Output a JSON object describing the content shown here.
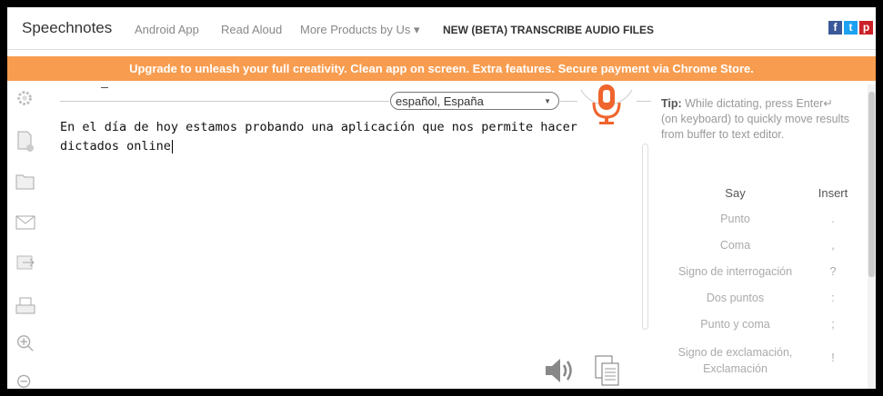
{
  "header": {
    "brand": "Speechnotes",
    "nav": [
      "Android App",
      "Read Aloud",
      "More Products by Us ▾"
    ],
    "nav_highlight": "NEW (BETA) TRANSCRIBE AUDIO FILES",
    "social": [
      {
        "icon": "facebook-icon",
        "glyph": "f",
        "color": "#3b5998"
      },
      {
        "icon": "twitter-icon",
        "glyph": "t",
        "color": "#1da1f2"
      },
      {
        "icon": "pinterest-icon",
        "glyph": "p",
        "color": "#cb2027"
      }
    ]
  },
  "banner": {
    "text": "Upgrade to unleash your full creativity. Clean app on screen. Extra features. Secure payment via Chrome Store.",
    "color": "#f89c4f"
  },
  "sidebar": {
    "icons": [
      "settings-icon",
      "new-file-icon",
      "open-folder-icon",
      "email-icon",
      "share-icon",
      "print-icon",
      "zoom-in-icon",
      "zoom-out-icon"
    ]
  },
  "editor": {
    "language": "español, España",
    "text": "En el día de hoy estamos probando una aplicación que nos permite hacer dictados online",
    "mic_color": "#f0642d"
  },
  "tips": {
    "label": "Tip:",
    "text": "While dictating, press Enter↵ (on keyboard) to quickly move results from buffer to text editor.",
    "table_headers": {
      "say": "Say",
      "insert": "Insert"
    },
    "commands": [
      {
        "say": "Punto",
        "insert": "."
      },
      {
        "say": "Coma",
        "insert": ","
      },
      {
        "say": "Signo de interrogación",
        "insert": "?"
      },
      {
        "say": "Dos puntos",
        "insert": ":"
      },
      {
        "say": "Punto y coma",
        "insert": ";"
      },
      {
        "say": "Signo de exclamación, Exclamación",
        "insert": "!"
      }
    ]
  },
  "bottom_toolbar": {
    "icons": [
      "speaker-icon",
      "clipboard-icon"
    ]
  }
}
